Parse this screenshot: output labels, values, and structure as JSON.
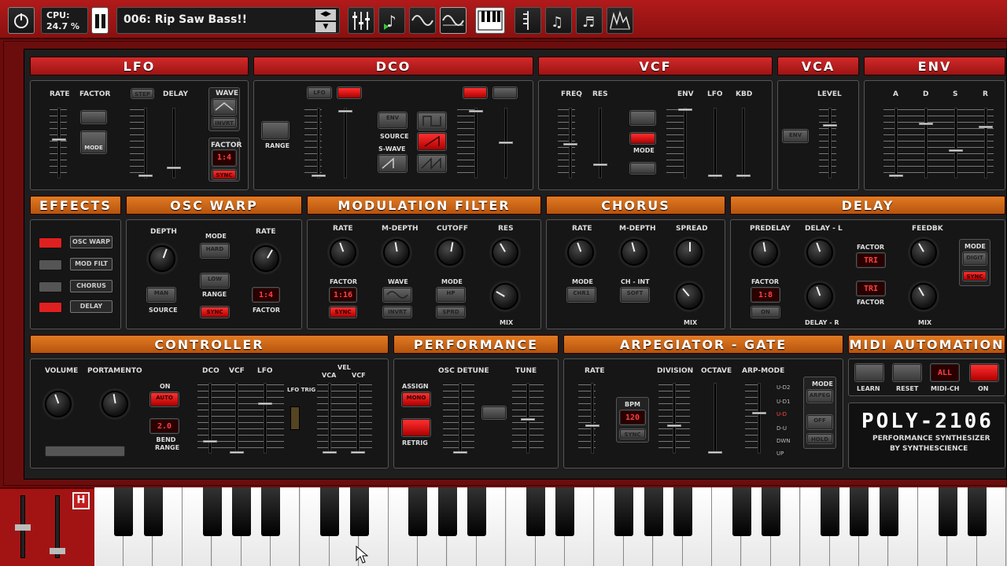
{
  "topbar": {
    "cpu_label": "CPU:",
    "cpu_value": "24.7 %",
    "preset_name": "006: Rip Saw Bass!!"
  },
  "sections": {
    "lfo": "LFO",
    "dco": "DCO",
    "vcf": "VCF",
    "vca": "VCA",
    "env": "ENV",
    "effects": "EFFECTS",
    "osc_warp": "OSC WARP",
    "mod_filter": "MODULATION FILTER",
    "chorus": "CHORUS",
    "delay": "DELAY",
    "controller": "CONTROLLER",
    "performance": "PERFORMANCE",
    "arpeggiator": "ARPEGIATOR - GATE",
    "midi": "MIDI AUTOMATION"
  },
  "lfo": {
    "rate": "RATE",
    "factor": "FACTOR",
    "delay": "DELAY",
    "wave": "WAVE",
    "mode": "MODE",
    "factor2": "FACTOR",
    "factor_value": "1:4",
    "invert": "INVRT",
    "step": "STEP",
    "sync": "SYNC"
  },
  "dco": {
    "range": "RANGE",
    "source": "SOURCE",
    "s_wave": "S-WAVE",
    "env": "ENV",
    "lfo": "LFO"
  },
  "vcf": {
    "freq": "FREQ",
    "res": "RES",
    "env": "ENV",
    "lfo": "LFO",
    "kbd": "KBD",
    "mode": "MODE"
  },
  "vca": {
    "level": "LEVEL",
    "env": "ENV"
  },
  "env": {
    "a": "A",
    "d": "D",
    "s": "S",
    "r": "R"
  },
  "effects": {
    "items": [
      "OSC WARP",
      "MOD FILT",
      "CHORUS",
      "DELAY"
    ]
  },
  "osc_warp": {
    "depth": "DEPTH",
    "mode": "MODE",
    "rate": "RATE",
    "source": "SOURCE",
    "range": "RANGE",
    "factor": "FACTOR",
    "factor_value": "1:4",
    "hard": "HARD",
    "low": "LOW",
    "man": "MAN",
    "sync": "SYNC"
  },
  "mod_filter": {
    "rate": "RATE",
    "m_depth": "M-DEPTH",
    "cutoff": "CUTOFF",
    "res": "RES",
    "factor": "FACTOR",
    "factor_value": "1:16",
    "wave": "WAVE",
    "mode": "MODE",
    "mode_value": "HP",
    "mix": "MIX",
    "invert": "INVRT",
    "spread": "SPRD",
    "sync": "SYNC"
  },
  "chorus": {
    "rate": "RATE",
    "m_depth": "M-DEPTH",
    "spread": "SPREAD",
    "mode": "MODE",
    "mode_value": "CHR1",
    "ch_int": "CH - INT",
    "soft": "SOFT",
    "mix": "MIX"
  },
  "delay": {
    "predelay": "PREDELAY",
    "delay_l": "DELAY - L",
    "feedbk": "FEEDBK",
    "mode": "MODE",
    "digit": "DIGIT",
    "factor": "FACTOR",
    "factor_value": "1:8",
    "tri": "TRI",
    "on": "ON",
    "delay_r": "DELAY - R",
    "mix": "MIX",
    "sync": "SYNC"
  },
  "controller": {
    "volume": "VOLUME",
    "portamento": "PORTAMENTO",
    "on": "ON",
    "auto": "AUTO",
    "bend_value": "2.0",
    "bend_range": "BEND RANGE",
    "dco": "DCO",
    "vcf": "VCF",
    "lfo": "LFO",
    "lfo_trig": "LFO TRIG",
    "vel": "VEL",
    "vca": "VCA",
    "vcf2": "VCF"
  },
  "performance": {
    "assign": "ASSIGN",
    "mono": "MONO",
    "retrig": "RETRIG",
    "osc_detune": "OSC DETUNE",
    "tune": "TUNE"
  },
  "arp": {
    "rate": "RATE",
    "bpm": "BPM",
    "bpm_value": "120",
    "sync": "SYNC",
    "division": "DIVISION",
    "octave": "OCTAVE",
    "arp_mode": "ARP-MODE",
    "mode": "MODE",
    "arpeg": "ARPEG",
    "off": "OFF",
    "hold": "HOLD",
    "modes": [
      "U-D2",
      "U-D1",
      "U-D",
      "D-U",
      "DWN",
      "UP"
    ]
  },
  "midi": {
    "learn": "LEARN",
    "reset": "RESET",
    "all": "ALL",
    "midi_ch": "MIDI-CH",
    "on": "ON"
  },
  "brand": {
    "name": "POLY-2106",
    "sub1": "PERFORMANCE SYNTHESIZER",
    "sub2": "BY SYNTHESCIENCE"
  },
  "keyboard": {
    "hold": "H"
  }
}
